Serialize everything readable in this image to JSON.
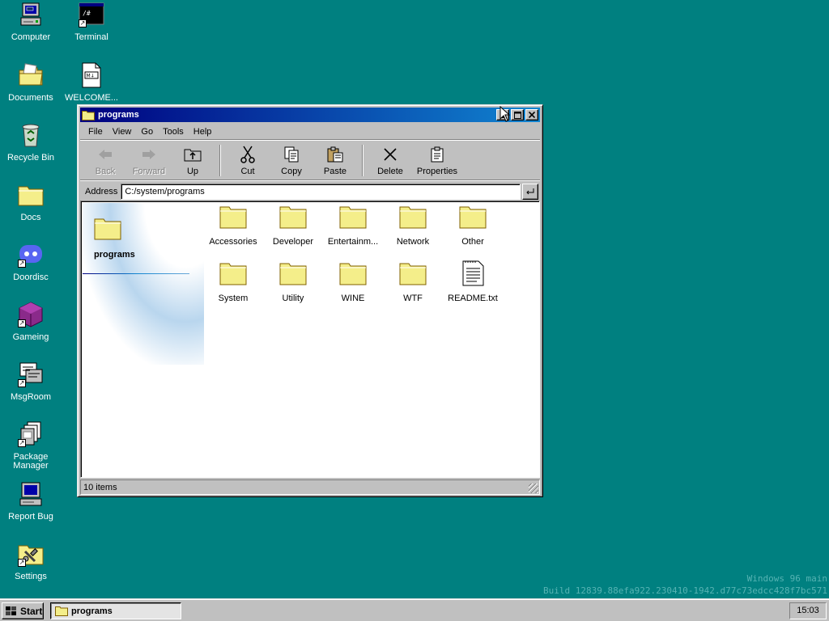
{
  "desktop": {
    "icons": [
      {
        "label": "Computer",
        "icon": "computer-icon"
      },
      {
        "label": "Terminal",
        "icon": "terminal-icon"
      },
      {
        "label": "Documents",
        "icon": "documents-folder-icon"
      },
      {
        "label": "WELCOME...",
        "icon": "markdown-file-icon"
      },
      {
        "label": "Recycle Bin",
        "icon": "recycle-bin-icon"
      },
      {
        "label": "Docs",
        "icon": "folder-icon"
      },
      {
        "label": "Doordisc",
        "icon": "doordisc-icon"
      },
      {
        "label": "Gameing",
        "icon": "cube-icon"
      },
      {
        "label": "MsgRoom",
        "icon": "msgroom-icon"
      },
      {
        "label": "Package Manager",
        "icon": "package-icon"
      },
      {
        "label": "Report Bug",
        "icon": "report-bug-icon"
      },
      {
        "label": "Settings",
        "icon": "settings-icon"
      }
    ],
    "terminal_glyph": "/#",
    "markdown_glyph": "M↓"
  },
  "window": {
    "title": "programs",
    "menu": [
      "File",
      "View",
      "Go",
      "Tools",
      "Help"
    ],
    "toolbar": {
      "back": "Back",
      "forward": "Forward",
      "up": "Up",
      "cut": "Cut",
      "copy": "Copy",
      "paste": "Paste",
      "delete": "Delete",
      "properties": "Properties"
    },
    "address_label": "Address",
    "address_value": "C:/system/programs",
    "side_title": "programs",
    "files": [
      {
        "label": "Accessories",
        "type": "folder"
      },
      {
        "label": "Developer",
        "type": "folder"
      },
      {
        "label": "Entertainm...",
        "type": "folder"
      },
      {
        "label": "Network",
        "type": "folder"
      },
      {
        "label": "Other",
        "type": "folder"
      },
      {
        "label": "System",
        "type": "folder"
      },
      {
        "label": "Utility",
        "type": "folder"
      },
      {
        "label": "WINE",
        "type": "folder"
      },
      {
        "label": "WTF",
        "type": "folder"
      },
      {
        "label": "README.txt",
        "type": "text-file"
      }
    ],
    "status": "10 items"
  },
  "taskbar": {
    "start_label": "Start",
    "task_label": "programs",
    "clock": "15:03"
  },
  "watermark": {
    "line1": "Windows 96 main",
    "line2": "Build 12839.88efa922.230410-1942.d77c73edcc428f7bc571"
  },
  "colors": {
    "desktop": "#008080",
    "titlebar_start": "#000080",
    "titlebar_end": "#1084d0",
    "folder_yellow": "#f4ee8a"
  }
}
